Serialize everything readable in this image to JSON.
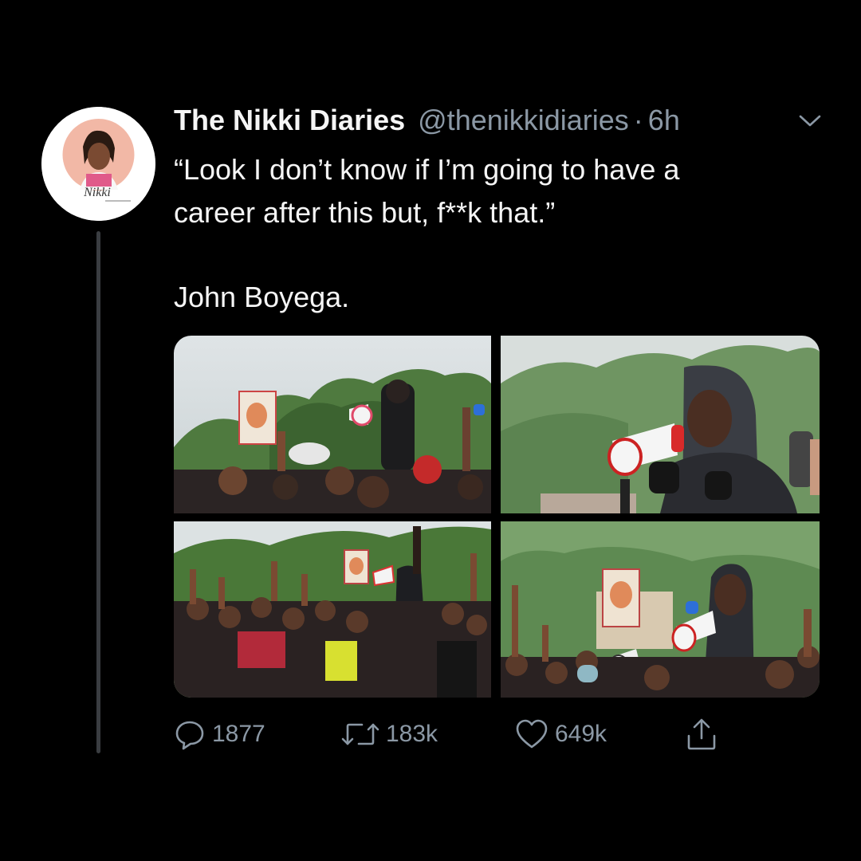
{
  "tweet": {
    "display_name": "The Nikki Diaries",
    "handle": "@thenikkidiaries",
    "separator": "·",
    "time": "6h",
    "text_line1": "“Look I don’t know if I’m going to have a",
    "text_line2": "career after this but, f**k that.”",
    "text_signature": "John Boyega.",
    "avatar_logo_text": "Nikki"
  },
  "actions": {
    "reply_count": "1877",
    "retweet_count": "183k",
    "like_count": "649k"
  },
  "icons": {
    "caret": "chevron-down-icon",
    "reply": "speech-bubble-icon",
    "retweet": "retweet-arrows-icon",
    "like": "heart-icon",
    "share": "share-upload-icon"
  },
  "colors": {
    "background": "#000000",
    "text": "#f5f5f5",
    "muted": "#8b98a5",
    "thread_line": "#3a3d41"
  }
}
